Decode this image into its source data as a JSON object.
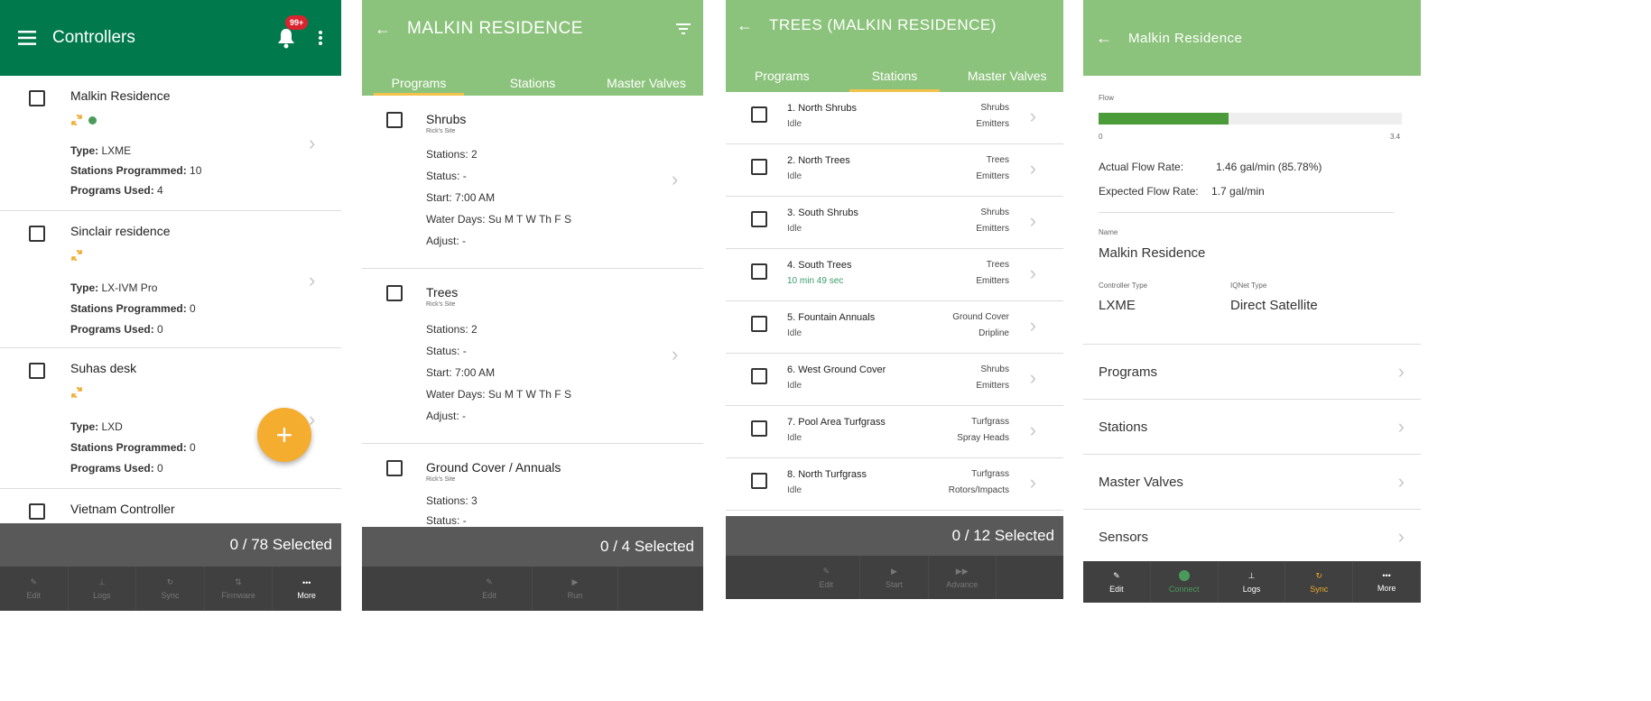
{
  "p1": {
    "title": "Controllers",
    "badge": "99+",
    "controllers": [
      {
        "name": "Malkin Residence",
        "type_label": "Type:",
        "type": "LXME",
        "stations_label": "Stations Programmed:",
        "stations": "10",
        "programs_label": "Programs Used:",
        "programs": "4"
      },
      {
        "name": "Sinclair residence",
        "type_label": "Type:",
        "type": "LX-IVM Pro",
        "stations_label": "Stations Programmed:",
        "stations": "0",
        "programs_label": "Programs Used:",
        "programs": "0"
      },
      {
        "name": "Suhas desk",
        "type_label": "Type:",
        "type": "LXD",
        "stations_label": "Stations Programmed:",
        "stations": "0",
        "programs_label": "Programs Used:",
        "programs": "0"
      },
      {
        "name": "Vietnam Controller"
      }
    ],
    "selected": "0 / 78 Selected",
    "actions": [
      "Edit",
      "Logs",
      "Sync",
      "Firmware",
      "More"
    ]
  },
  "p2": {
    "title": "MALKIN RESIDENCE",
    "tabs": [
      "Programs",
      "Stations",
      "Master Valves"
    ],
    "programs": [
      {
        "name": "Shrubs",
        "site": "Rick's Site",
        "stations_label": "Stations:",
        "stations": "2",
        "status_label": "Status:",
        "status": "-",
        "start_label": "Start:",
        "start": "7:00 AM",
        "days_label": "Water Days:",
        "days": "Su M T W Th F S",
        "adjust_label": "Adjust:",
        "adjust": "-"
      },
      {
        "name": "Trees",
        "site": "Rick's Site",
        "stations_label": "Stations:",
        "stations": "2",
        "status_label": "Status:",
        "status": "-",
        "start_label": "Start:",
        "start": "7:00 AM",
        "days_label": "Water Days:",
        "days": "Su M T W Th F S",
        "adjust_label": "Adjust:",
        "adjust": "-"
      },
      {
        "name": "Ground Cover / Annuals",
        "site": "Rick's Site",
        "stations_label": "Stations:",
        "stations": "3",
        "status_label": "Status:",
        "status": "-"
      }
    ],
    "selected": "0 / 4 Selected",
    "actions": [
      "Edit",
      "Run"
    ]
  },
  "p3": {
    "title": "TREES (MALKIN RESIDENCE)",
    "tabs": [
      "Programs",
      "Stations",
      "Master Valves"
    ],
    "stations": [
      {
        "name": "1. North Shrubs",
        "status": "Idle",
        "plant": "Shrubs",
        "head": "Emitters"
      },
      {
        "name": "2. North Trees",
        "status": "Idle",
        "plant": "Trees",
        "head": "Emitters"
      },
      {
        "name": "3. South Shrubs",
        "status": "Idle",
        "plant": "Shrubs",
        "head": "Emitters"
      },
      {
        "name": "4. South Trees",
        "status": "10 min 49 sec",
        "plant": "Trees",
        "head": "Emitters"
      },
      {
        "name": "5. Fountain Annuals",
        "status": "Idle",
        "plant": "Ground Cover",
        "head": "Dripline"
      },
      {
        "name": "6. West Ground Cover",
        "status": "Idle",
        "plant": "Shrubs",
        "head": "Emitters"
      },
      {
        "name": "7. Pool Area Turfgrass",
        "status": "Idle",
        "plant": "Turfgrass",
        "head": "Spray Heads"
      },
      {
        "name": "8. North Turfgrass",
        "status": "Idle",
        "plant": "Turfgrass",
        "head": "Rotors/Impacts"
      }
    ],
    "selected": "0 / 12 Selected",
    "actions": [
      "Edit",
      "Start",
      "Advance"
    ]
  },
  "p4": {
    "title": "Malkin Residence",
    "flow_label": "Flow",
    "flow_fraction": 0.4294,
    "flow_min": "0",
    "flow_max": "3.4",
    "actual_label": "Actual Flow Rate:",
    "actual": "1.46 gal/min (85.78%)",
    "expected_label": "Expected Flow Rate:",
    "expected": "1.7 gal/min",
    "name_label": "Name",
    "name": "Malkin Residence",
    "ctype_label": "Controller Type",
    "ctype": "LXME",
    "iqnet_label": "IQNet Type",
    "iqnet": "Direct Satellite",
    "nav": [
      "Programs",
      "Stations",
      "Master Valves",
      "Sensors"
    ],
    "actions": [
      "Edit",
      "Connect",
      "Logs",
      "Sync",
      "More"
    ]
  },
  "colors": {
    "dark_green": "#007a4d",
    "light_green": "#8cc37c",
    "accent": "#f4ad2f",
    "badge": "#d9242f"
  }
}
